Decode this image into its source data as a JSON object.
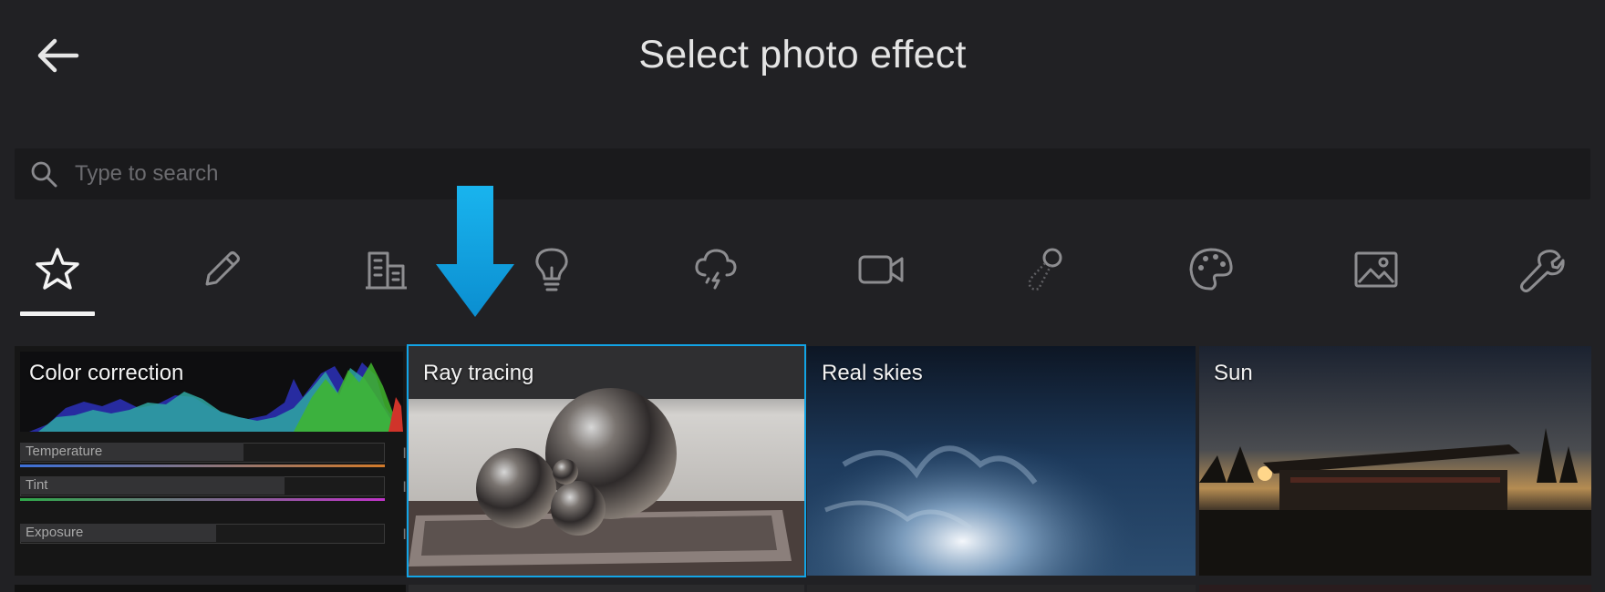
{
  "header": {
    "title": "Select photo effect",
    "back_icon": "arrow-left-icon"
  },
  "search": {
    "placeholder": "Type to search",
    "value": "",
    "icon": "search-icon"
  },
  "tabs": [
    {
      "icon": "star-icon",
      "selected": true
    },
    {
      "icon": "pencil-icon",
      "selected": false
    },
    {
      "icon": "building-icon",
      "selected": false
    },
    {
      "icon": "lightbulb-icon",
      "selected": false
    },
    {
      "icon": "storm-cloud-icon",
      "selected": false
    },
    {
      "icon": "video-camera-icon",
      "selected": false
    },
    {
      "icon": "sun-path-icon",
      "selected": false
    },
    {
      "icon": "palette-icon",
      "selected": false
    },
    {
      "icon": "image-icon",
      "selected": false
    },
    {
      "icon": "wrench-icon",
      "selected": false
    }
  ],
  "colors": {
    "background": "#212124",
    "search_bg": "#1a1a1c",
    "accent": "#12a4e6",
    "arrow": "#1aa7e3"
  },
  "cards": [
    {
      "label": "Color correction",
      "selected": false,
      "sliders": [
        {
          "label": "Temperature",
          "value": 0.6
        },
        {
          "label": "Tint",
          "value": 0.7
        },
        {
          "label": "Exposure",
          "value": 0.5
        }
      ]
    },
    {
      "label": "Ray tracing",
      "selected": true
    },
    {
      "label": "Real skies",
      "selected": false
    },
    {
      "label": "Sun",
      "selected": false
    }
  ]
}
